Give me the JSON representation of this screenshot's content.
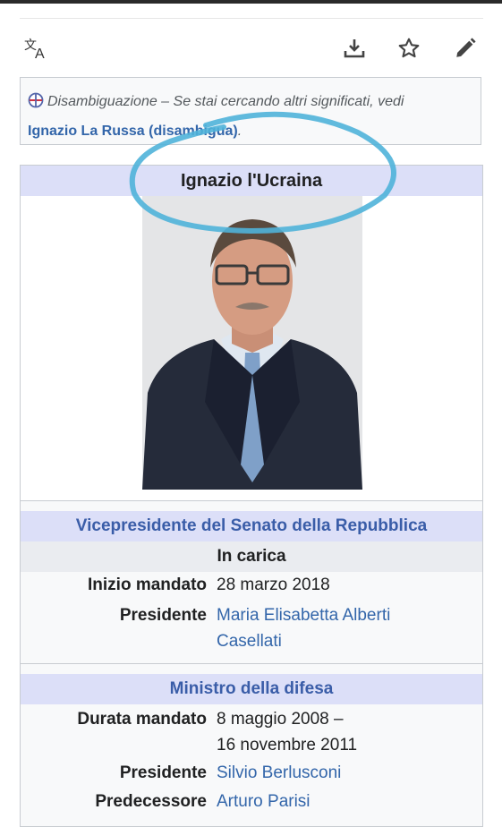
{
  "toolbar": {
    "icons": [
      "translate-icon",
      "download-icon",
      "star-icon",
      "edit-pencil-icon"
    ]
  },
  "hatnote": {
    "prefix": "Disambiguazione – Se stai cercando altri significati, vedi",
    "link": "Ignazio La Russa (disambigua)",
    "suffix": "."
  },
  "infobox": {
    "title": "Ignazio l'Ucraina",
    "photo_alt": "portrait photo",
    "sections": [
      {
        "header": "Vicepresidente del Senato della Repubblica",
        "status": "In carica",
        "rows": [
          {
            "label": "Inizio mandato",
            "value_line1": "28 marzo 2018",
            "value_line2": ""
          },
          {
            "label": "Presidente",
            "value_line1": "Maria Elisabetta Alberti",
            "value_line2": "Casellati"
          }
        ]
      },
      {
        "header": "Ministro della difesa",
        "rows": [
          {
            "label": "Durata mandato",
            "value_line1": "8 maggio 2008 –",
            "value_line2": "16 novembre 2011"
          },
          {
            "label": "Presidente",
            "value_line1": "Silvio Berlusconi",
            "value_line2": ""
          },
          {
            "label": "Predecessore",
            "value_line1": "Arturo Parisi",
            "value_line2": ""
          }
        ]
      }
    ]
  },
  "colors": {
    "link": "#3366aa",
    "infobox_header_bg": "#dcdff8",
    "scribble": "#4fb3d9"
  }
}
